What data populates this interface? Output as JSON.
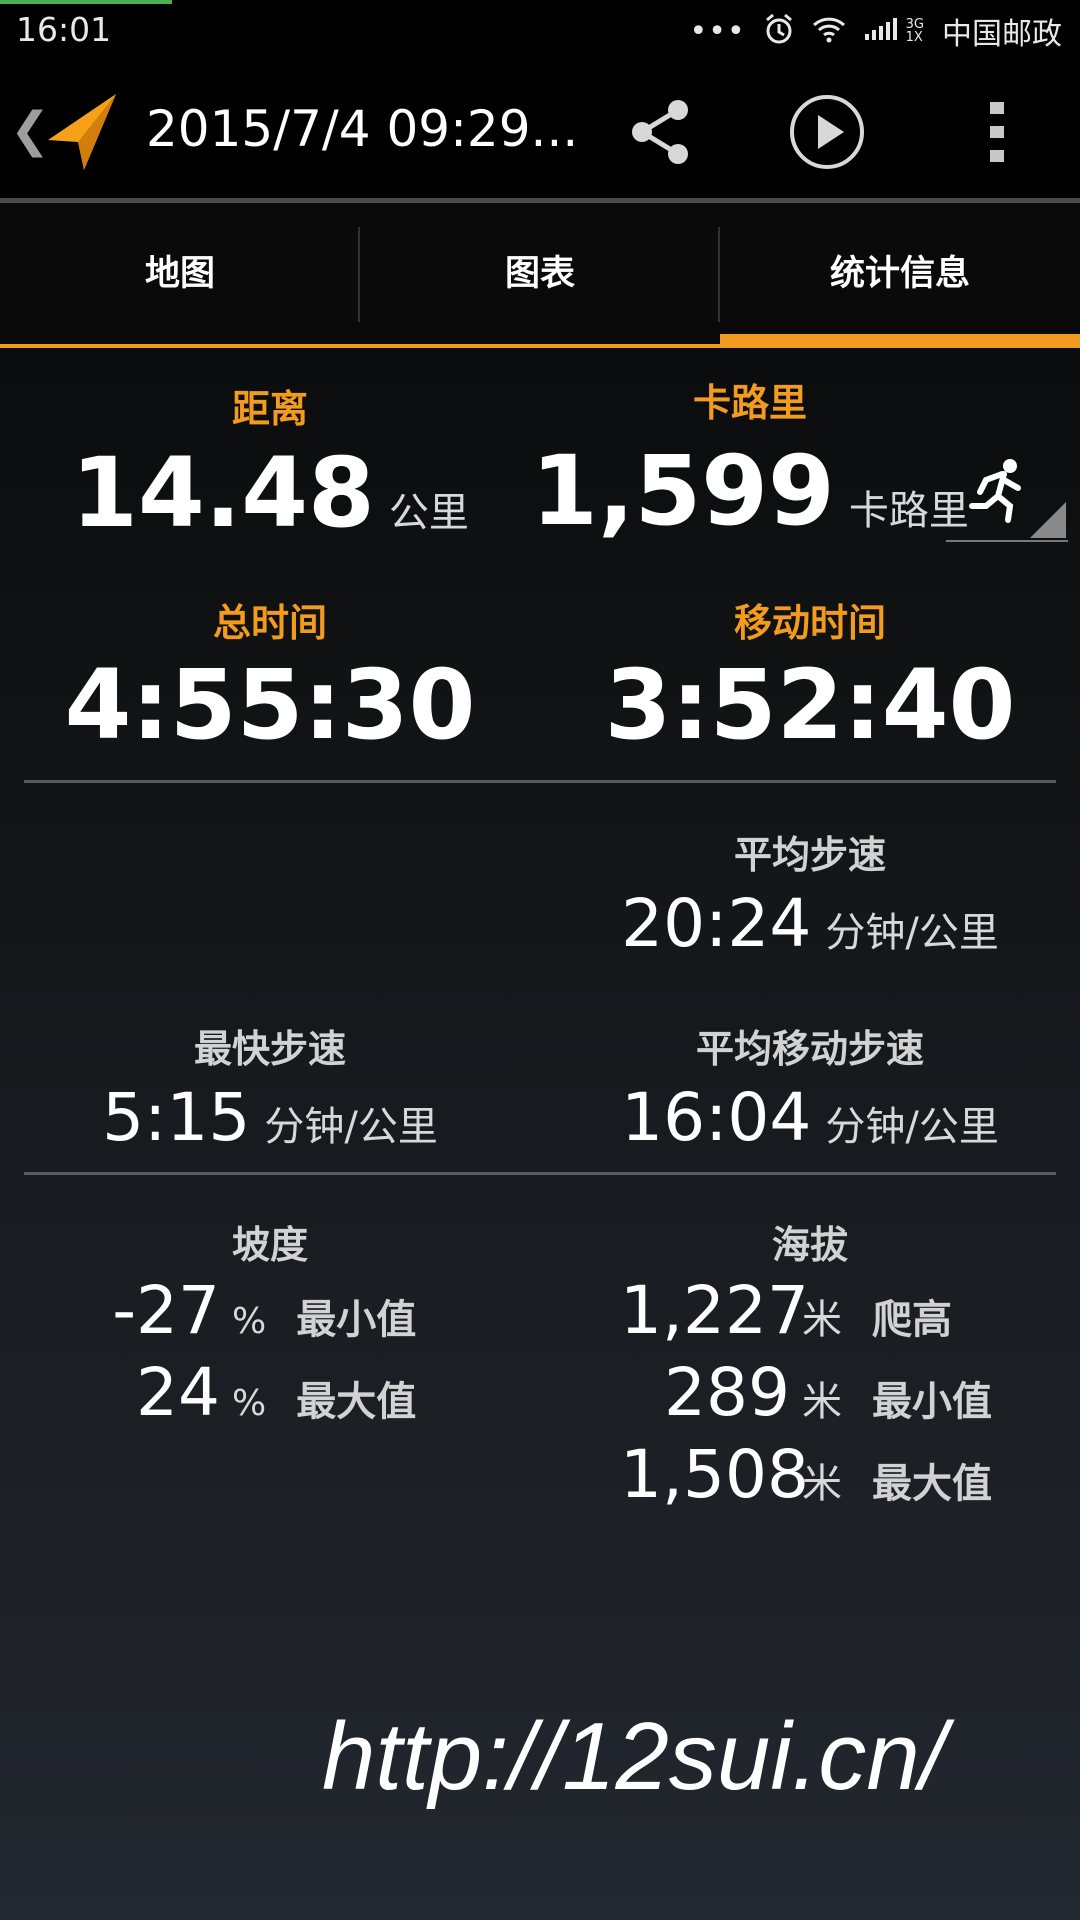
{
  "status_bar": {
    "time": "16:01",
    "dots": "•••",
    "network_top": "3G",
    "network_bottom": "1X",
    "carrier": "中国邮政"
  },
  "action_bar": {
    "title": "2015/7/4 09:29...",
    "back_glyph": "❮"
  },
  "tabs": [
    {
      "label": "地图",
      "active": false
    },
    {
      "label": "图表",
      "active": false
    },
    {
      "label": "统计信息",
      "active": true
    }
  ],
  "stats": {
    "distance": {
      "label": "距离",
      "value": "14.48",
      "unit": "公里"
    },
    "calories": {
      "label": "卡路里",
      "value": "1,599",
      "unit": "卡路里"
    },
    "total_time": {
      "label": "总时间",
      "value": "4:55:30"
    },
    "moving_time": {
      "label": "移动时间",
      "value": "3:52:40"
    },
    "avg_pace": {
      "label": "平均步速",
      "value": "20:24",
      "unit": "分钟/公里"
    },
    "fastest_pace": {
      "label": "最快步速",
      "value": "5:15",
      "unit": "分钟/公里"
    },
    "avg_moving_pace": {
      "label": "平均移动步速",
      "value": "16:04",
      "unit": "分钟/公里"
    },
    "grade": {
      "label": "坡度",
      "rows": [
        {
          "value": "-27",
          "unit": "%",
          "label": "最小值"
        },
        {
          "value": "24",
          "unit": "%",
          "label": "最大值"
        }
      ]
    },
    "elevation": {
      "label": "海拔",
      "rows": [
        {
          "value": "1,227",
          "unit": "米",
          "label": "爬高"
        },
        {
          "value": "289",
          "unit": "米",
          "label": "最小值"
        },
        {
          "value": "1,508",
          "unit": "米",
          "label": "最大值"
        }
      ]
    }
  },
  "watermark": "http://12sui.cn/",
  "colors": {
    "accent": "#f39b1f",
    "background": "#000000",
    "status_progress": "#4caf50"
  }
}
